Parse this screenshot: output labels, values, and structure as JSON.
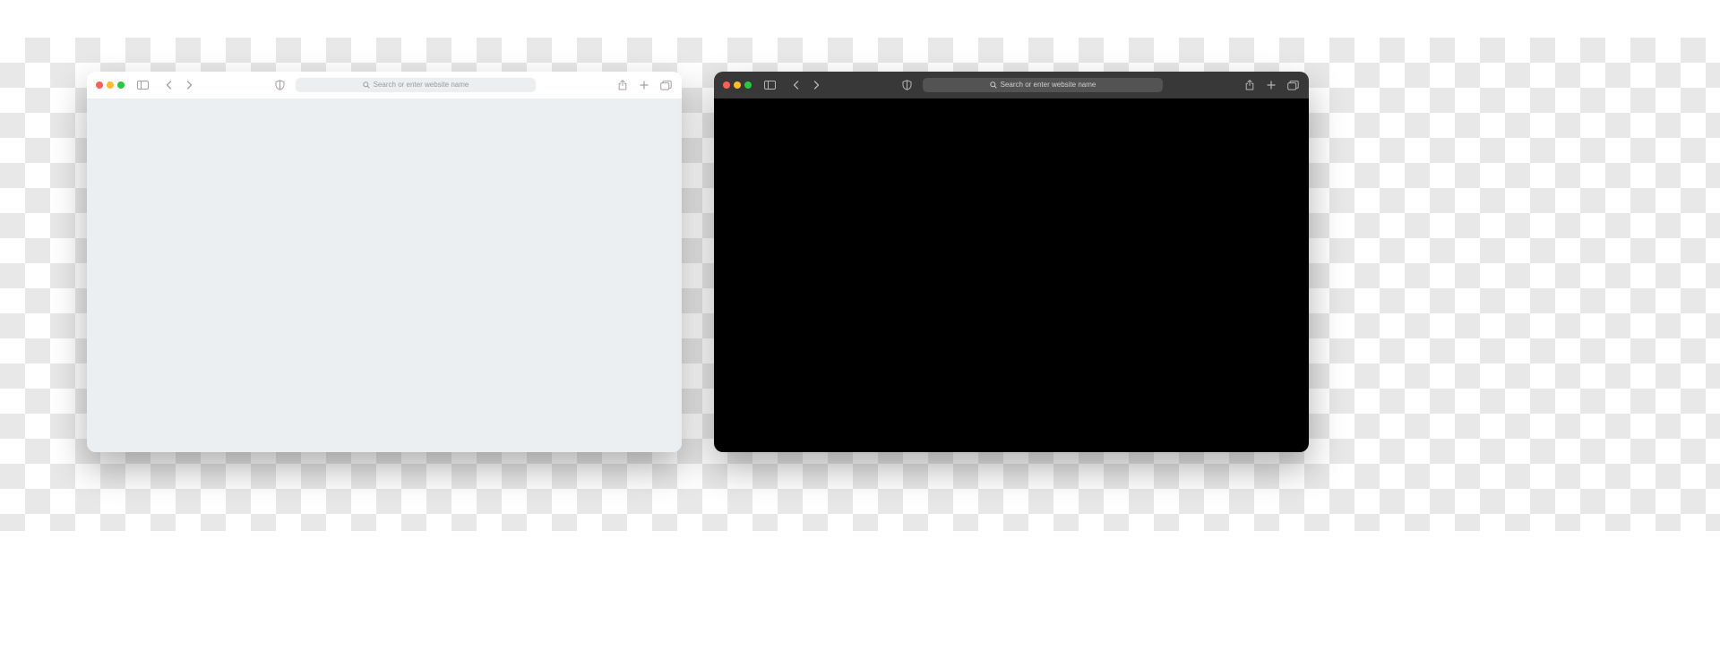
{
  "light": {
    "search_placeholder": "Search or enter website name"
  },
  "dark": {
    "search_placeholder": "Search or enter website name"
  },
  "colors": {
    "traffic_red": "#ff5f57",
    "traffic_yellow": "#febc2e",
    "traffic_green": "#28c840",
    "light_toolbar": "#ffffff",
    "light_viewport": "#eceff1",
    "light_address_bg": "#edeef0",
    "dark_toolbar": "#383838",
    "dark_viewport": "#000000",
    "dark_address_bg": "#535353"
  }
}
